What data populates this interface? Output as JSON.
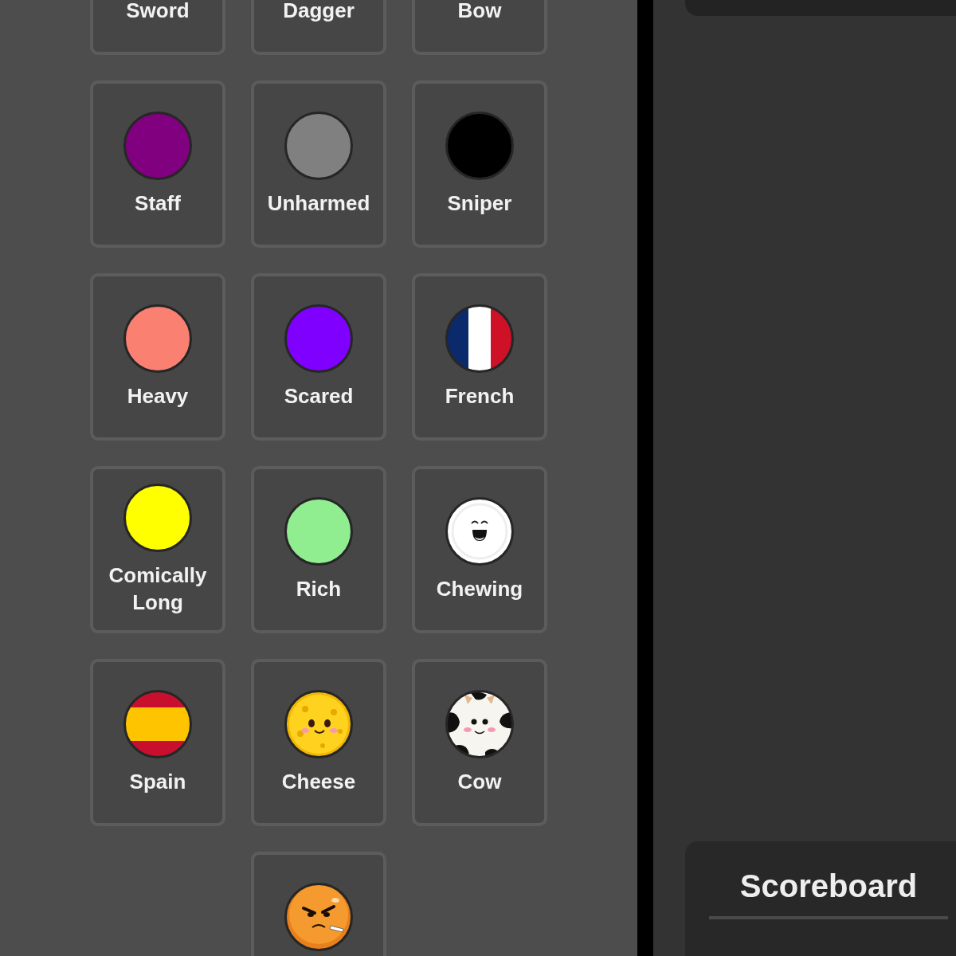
{
  "items": [
    {
      "label": "Sword",
      "kind": "hidden"
    },
    {
      "label": "Dagger",
      "kind": "hidden"
    },
    {
      "label": "Bow",
      "kind": "hidden"
    },
    {
      "label": "Staff",
      "kind": "swatch",
      "color": "#800080"
    },
    {
      "label": "Unharmed",
      "kind": "swatch",
      "color": "#808080"
    },
    {
      "label": "Sniper",
      "kind": "swatch",
      "color": "#000000"
    },
    {
      "label": "Heavy",
      "kind": "swatch",
      "color": "#fa8072"
    },
    {
      "label": "Scared",
      "kind": "swatch",
      "color": "#8000ff"
    },
    {
      "label": "French",
      "kind": "flag-tricolor"
    },
    {
      "label": "Comically Long",
      "kind": "swatch",
      "color": "#ffff00"
    },
    {
      "label": "Rich",
      "kind": "swatch",
      "color": "#90ee90"
    },
    {
      "label": "Chewing",
      "kind": "laughing-face"
    },
    {
      "label": "Spain",
      "kind": "flag-bands"
    },
    {
      "label": "Cheese",
      "kind": "cheese-face"
    },
    {
      "label": "Cow",
      "kind": "cow-face"
    },
    {
      "kind": "angry-face"
    }
  ],
  "scoreboard": {
    "title": "Scoreboard"
  }
}
